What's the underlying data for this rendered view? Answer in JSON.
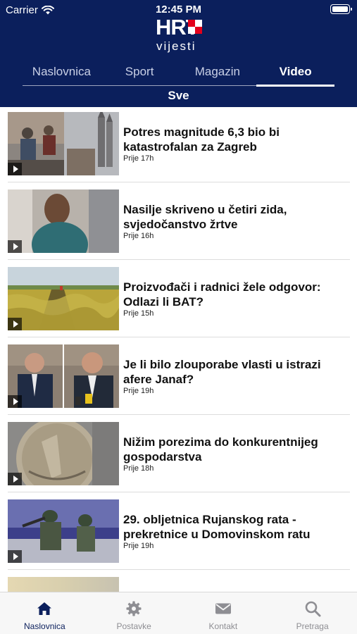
{
  "status": {
    "carrier": "Carrier",
    "time": "12:45 PM"
  },
  "logo": {
    "mark": "HRT",
    "sub": "vijesti"
  },
  "tabs": [
    {
      "label": "Naslovnica"
    },
    {
      "label": "Sport"
    },
    {
      "label": "Magazin"
    },
    {
      "label": "Video"
    }
  ],
  "active_tab": "Video",
  "subtab": "Sve",
  "articles": [
    {
      "title": "Potres magnitude 6,3 bio bi katastrofalan za Zagreb",
      "time": "Prije 17h"
    },
    {
      "title": "Nasilje skriveno u četiri zida, svjedočanstvo žrtve",
      "time": "Prije 16h"
    },
    {
      "title": "Proizvođači i radnici žele odgovor: Odlazi li BAT?",
      "time": "Prije 15h"
    },
    {
      "title": "Je li bilo zlouporabe vlasti u istrazi afere Janaf?",
      "time": "Prije 19h"
    },
    {
      "title": "Nižim porezima do konkurentnijeg gospodarstva",
      "time": "Prije 18h"
    },
    {
      "title": "29. obljetnica Rujanskog rata - prekretnice u Domovinskom ratu",
      "time": "Prije 19h"
    }
  ],
  "tabbar": [
    {
      "label": "Naslovnica",
      "icon": "home-icon"
    },
    {
      "label": "Postavke",
      "icon": "gear-icon"
    },
    {
      "label": "Kontakt",
      "icon": "envelope-icon"
    },
    {
      "label": "Pretraga",
      "icon": "search-icon"
    }
  ],
  "colors": {
    "header": "#0b1f5c",
    "logo_red": "#e3001b",
    "active_tab_icon": "#0b1f5c"
  }
}
